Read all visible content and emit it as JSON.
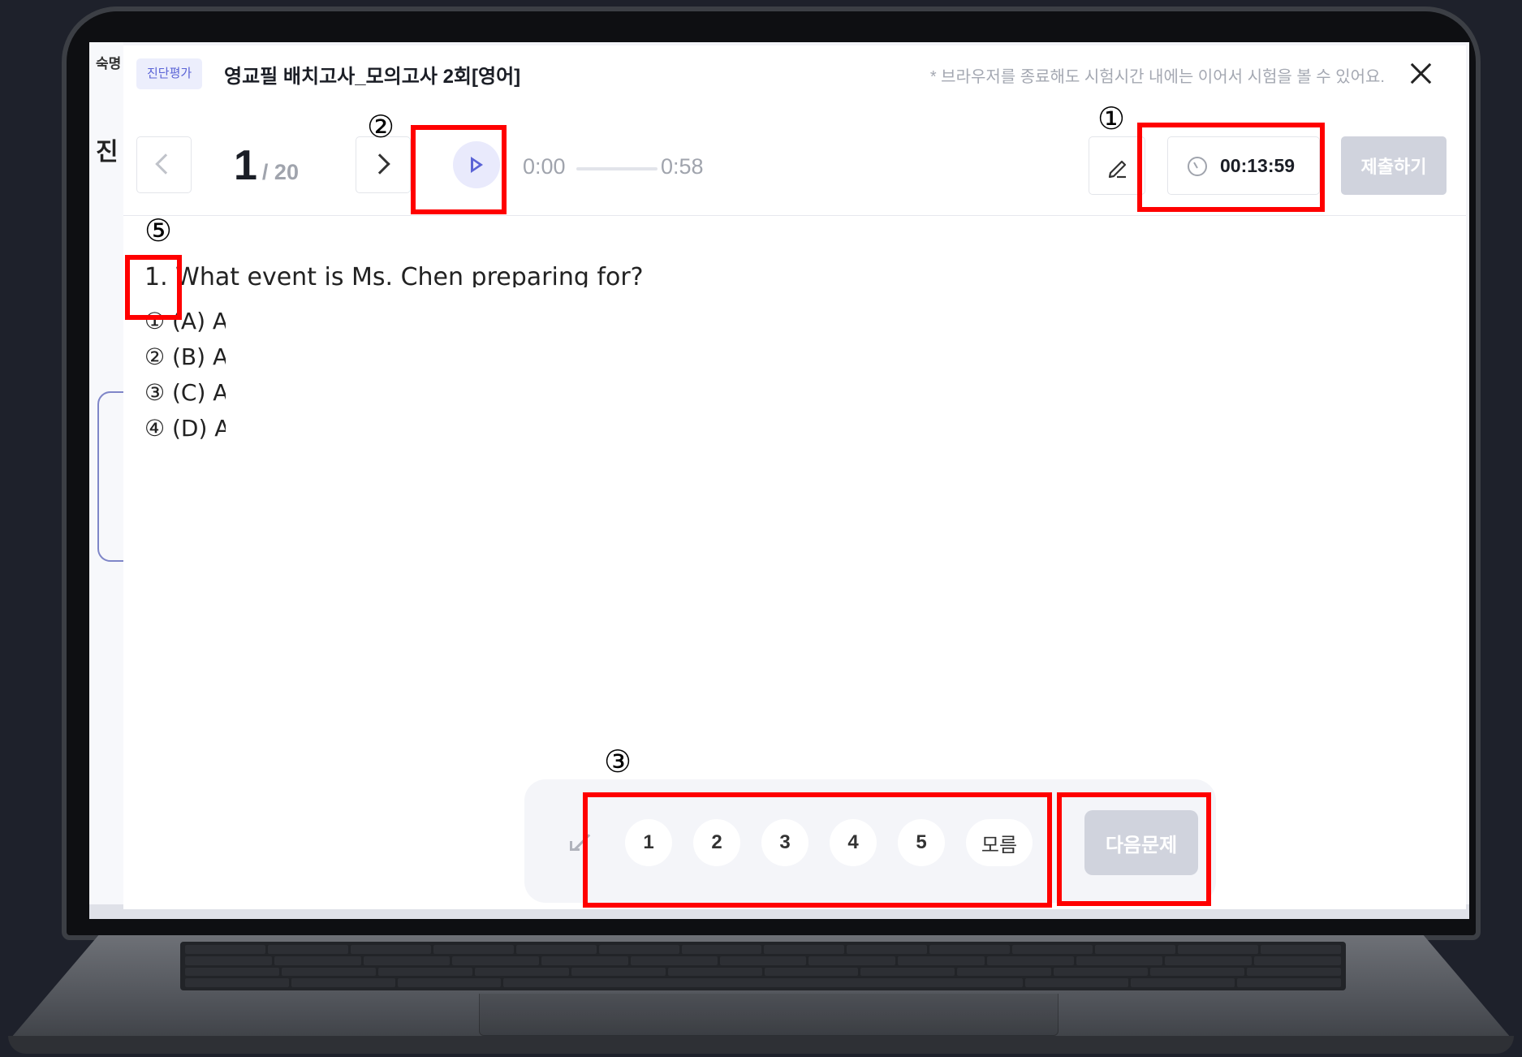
{
  "background": {
    "partial_label_top": "숙명",
    "partial_label_left": "진"
  },
  "header": {
    "tag": "진단평가",
    "title": "영교필 배치고사_모의고사 2회[영어]",
    "notice": "* 브라우저를 종료해도 시험시간 내에는 이어서 시험을 볼 수 있어요."
  },
  "toolbar": {
    "current_question": "1",
    "total_questions": "/ 20",
    "audio_start": "0:00",
    "audio_end": "0:58",
    "timer": "00:13:59",
    "submit_label": "제출하기"
  },
  "question": {
    "text": "1. What event is Ms. Chen preparing for?",
    "options": [
      "① (A) A",
      "② (B) A",
      "③ (C) A",
      "④ (D) A"
    ]
  },
  "answer_panel": {
    "choices": [
      "1",
      "2",
      "3",
      "4",
      "5"
    ],
    "unknown_label": "모름",
    "next_label": "다음문제"
  },
  "annotations": {
    "timer": "①",
    "audio": "②",
    "choices": "③",
    "question_number": "⑤"
  },
  "colors": {
    "accent": "#5a63d6",
    "annotation": "#ff0000",
    "disabled_button": "#d0d3dd"
  }
}
